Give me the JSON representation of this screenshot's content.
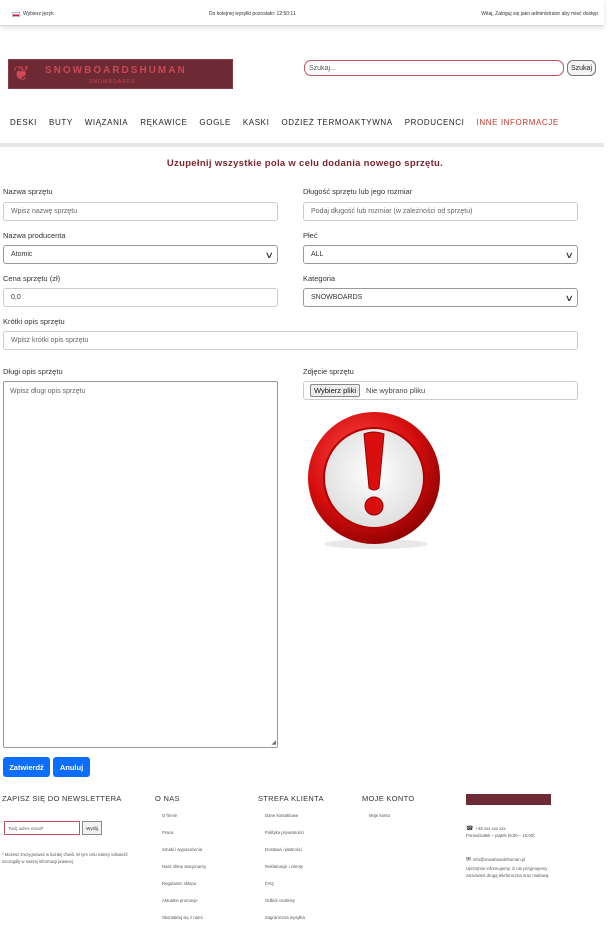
{
  "topbar": {
    "language": "Wybierz język",
    "shipping": "Do kolejnej wysyłki pozostało: 12:50:11",
    "greeting": "Witaj, Zaloguj się jako administrator aby mieć dostęp"
  },
  "logo": {
    "brand": "SNOWBOARDSHUMAN",
    "sub": "SNOWBOARDS"
  },
  "search": {
    "placeholder": "Szukaj...",
    "button": "Szukaj"
  },
  "nav": {
    "items": [
      "DESKI",
      "BUTY",
      "WIĄZANIA",
      "RĘKAWICE",
      "GOGLE",
      "KASKI",
      "ODZIEŻ TERMOAKTYWNA",
      "PRODUCENCI"
    ],
    "info": "INNE INFORMACJE"
  },
  "form": {
    "title": "Uzupełnij wszystkie pola w celu dodania nowego sprzętu.",
    "name_label": "Nazwa sprzętu",
    "name_placeholder": "Wpisz nazwę sprzętu",
    "length_label": "Długość sprzętu lub jego rozmiar",
    "length_placeholder": "Podaj długość lub rozmiar (w zależności od sprzętu)",
    "producer_label": "Nazwa producenta",
    "producer_value": "Atomic",
    "gender_label": "Płeć",
    "gender_value": "ALL",
    "price_label": "Cena sprzętu (zł)",
    "price_value": "0,0",
    "category_label": "Kategoria",
    "category_value": "SNOWBOARDS",
    "short_label": "Krótki opis sprzętu",
    "short_placeholder": "Wpisz krótki opis sprzętu",
    "long_label": "Długi opis sprzętu",
    "long_placeholder": "Wpisz długi opis sprzętu",
    "image_label": "Zdjęcie sprzętu",
    "file_button": "Wybierz pliki",
    "file_status": "Nie wybrano pliku",
    "submit": "Zatwierdź",
    "cancel": "Anuluj"
  },
  "footer": {
    "newsletter": {
      "heading": "ZAPISZ SIĘ DO NEWSLETTERA",
      "placeholder": "Twój adres email*",
      "button": "Wyślij",
      "note": "* Możesz zrezygnować w każdej chwili. W tym celu należy odnaleźć szczegóły w naszej informacji prawnej."
    },
    "about": {
      "heading": "O NAS",
      "links": [
        "O firmie",
        "Praca",
        "Smaki i wyposażenia",
        "Nasz sklep stacjonarny",
        "Regulamin sklepu",
        "Aktualne promocje",
        "Skontaktuj się z nami"
      ]
    },
    "client": {
      "heading": "STREFA KLIENTA",
      "links": [
        "Dane kontaktowe",
        "Polityka prywatności",
        "Dostawa i płatności",
        "Reklamacje i zwroty",
        "FAQ",
        "Odbiór osobisty",
        "Zagraniczna wysyłka"
      ]
    },
    "account": {
      "heading": "MOJE KONTO",
      "links": [
        "Moje konto"
      ]
    },
    "contact": {
      "phone": "+48 xxx xxx xxx",
      "hours": "Poniedziałek – piątek (8:00 – 16:00)",
      "email": "info@snowboardshuman.pl",
      "note": "Uprzejmie informujemy, iż nie przyjmujemy zamówień drogą telefoniczną oraz mailową."
    }
  },
  "colors": {
    "accent": "#7b2530",
    "primary": "#0d6efd",
    "nav_info": "#c0392b"
  }
}
